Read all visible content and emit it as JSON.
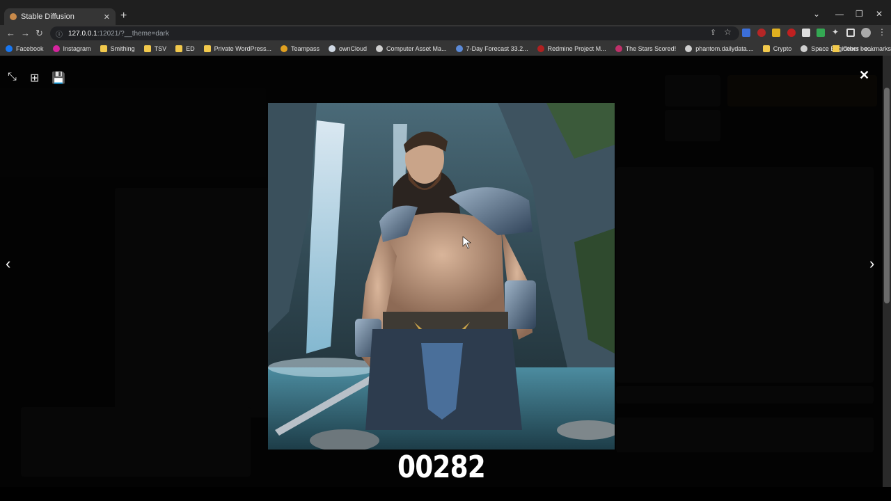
{
  "browser": {
    "tab_title": "Stable Diffusion",
    "new_tab": "+",
    "url_host": "127.0.0.1",
    "url_rest": ":12021/?__theme=dark",
    "bookmarks": [
      {
        "label": "Facebook",
        "icon": "facebook-icon",
        "color": "#1877f2"
      },
      {
        "label": "Instagram",
        "icon": "instagram-icon",
        "color": "#d6249f"
      },
      {
        "label": "Smithing",
        "icon": "folder-icon",
        "color": "#f2c94c"
      },
      {
        "label": "TSV",
        "icon": "folder-icon",
        "color": "#f2c94c"
      },
      {
        "label": "ED",
        "icon": "folder-icon",
        "color": "#f2c94c"
      },
      {
        "label": "Private WordPress...",
        "icon": "folder-icon",
        "color": "#f2c94c"
      },
      {
        "label": "Teampass",
        "icon": "teampass-icon",
        "color": "#e0a020"
      },
      {
        "label": "ownCloud",
        "icon": "cloud-icon",
        "color": "#cfd8e3"
      },
      {
        "label": "Computer Asset Ma...",
        "icon": "globe-icon",
        "color": "#cfcfcf"
      },
      {
        "label": "7-Day Forecast 33.2...",
        "icon": "weather-icon",
        "color": "#5b8ad8"
      },
      {
        "label": "Redmine Project M...",
        "icon": "redmine-icon",
        "color": "#b02020"
      },
      {
        "label": "The Stars Scored!",
        "icon": "stars-icon",
        "color": "#c0306a"
      },
      {
        "label": "phantom.dailydata....",
        "icon": "globe-icon",
        "color": "#cfcfcf"
      },
      {
        "label": "Crypto",
        "icon": "folder-icon",
        "color": "#f2c94c"
      },
      {
        "label": "Space Engineers - e...",
        "icon": "globe-icon",
        "color": "#cfcfcf"
      }
    ],
    "more_bookmarks": "»",
    "other_bookmarks": "Other bookmarks"
  },
  "viewer": {
    "image_number": "00282"
  }
}
